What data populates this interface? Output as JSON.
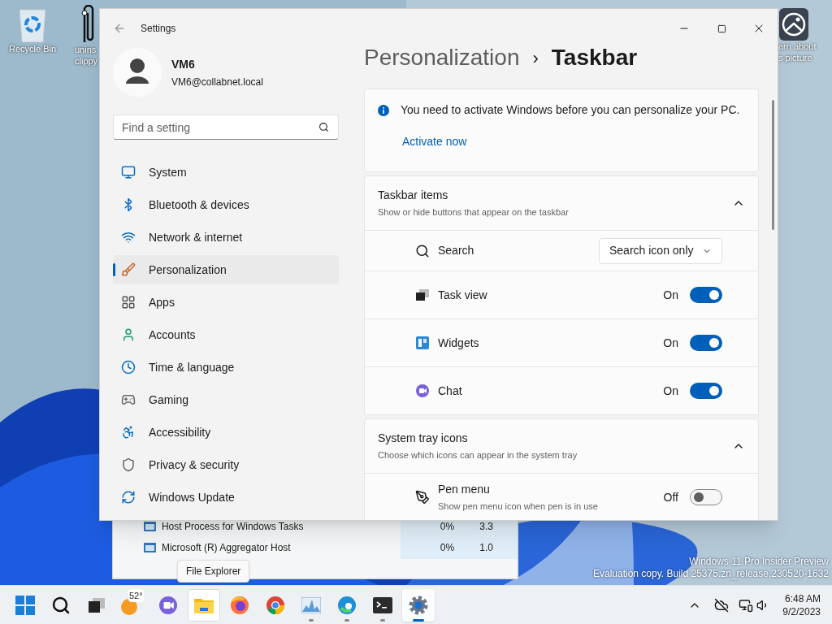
{
  "desktop_icons": [
    {
      "lines": [
        "Recycle Bin"
      ]
    },
    {
      "lines": [
        "unins",
        "clippy"
      ]
    },
    {
      "lines": [
        "arn about",
        "s picture"
      ]
    }
  ],
  "watermark_os": [
    "Windows 11 Pro Insider Preview",
    "Evaluation copy. Build 25375.zn_release.230520-1632"
  ],
  "background_window": {
    "rows": [
      {
        "name": "Host Process for Windows Tasks",
        "cpu": "0%",
        "memory": "3.3"
      },
      {
        "name": "Microsoft (R) Aggregator Host",
        "cpu": "0%",
        "memory": "1.0"
      }
    ]
  },
  "tooltip": "File Explorer",
  "settings": {
    "title": "Settings",
    "user": {
      "name": "VM6",
      "email": "VM6@collabnet.local"
    },
    "search": {
      "placeholder": "Find a setting"
    },
    "nav": [
      {
        "label": "System",
        "selected": false
      },
      {
        "label": "Bluetooth & devices",
        "selected": false
      },
      {
        "label": "Network & internet",
        "selected": false
      },
      {
        "label": "Personalization",
        "selected": true
      },
      {
        "label": "Apps",
        "selected": false
      },
      {
        "label": "Accounts",
        "selected": false
      },
      {
        "label": "Time & language",
        "selected": false
      },
      {
        "label": "Gaming",
        "selected": false
      },
      {
        "label": "Accessibility",
        "selected": false
      },
      {
        "label": "Privacy & security",
        "selected": false
      },
      {
        "label": "Windows Update",
        "selected": false
      }
    ],
    "breadcrumb": {
      "parent": "Personalization",
      "separator": "›",
      "current": "Taskbar"
    },
    "notice": {
      "text": "You need to activate Windows before you can personalize your PC.",
      "link": "Activate now"
    },
    "sections": [
      {
        "title": "Taskbar items",
        "subtitle": "Show or hide buttons that appear on the taskbar",
        "expanded": true,
        "rows": [
          {
            "kind": "dropdown",
            "label": "Search",
            "value": "Search icon only"
          },
          {
            "kind": "toggle",
            "label": "Task view",
            "state_label": "On",
            "on": true
          },
          {
            "kind": "toggle",
            "label": "Widgets",
            "state_label": "On",
            "on": true
          },
          {
            "kind": "toggle",
            "label": "Chat",
            "state_label": "On",
            "on": true
          }
        ]
      },
      {
        "title": "System tray icons",
        "subtitle": "Choose which icons can appear in the system tray",
        "expanded": true,
        "rows": [
          {
            "kind": "toggle",
            "label": "Pen menu",
            "description": "Show pen menu icon when pen is in use",
            "state_label": "Off",
            "on": false
          }
        ]
      }
    ]
  },
  "taskbar": {
    "apps": [
      {
        "running": false,
        "selected": false,
        "hovered": false
      },
      {
        "running": false,
        "selected": false,
        "hovered": false
      },
      {
        "running": false,
        "selected": false,
        "hovered": false
      },
      {
        "running": false,
        "selected": false,
        "hovered": false,
        "badge": "52°"
      },
      {
        "running": false,
        "selected": false,
        "hovered": false
      },
      {
        "running": false,
        "selected": false,
        "hovered": true
      },
      {
        "running": false,
        "selected": false,
        "hovered": false
      },
      {
        "running": false,
        "selected": false,
        "hovered": false
      },
      {
        "running": true,
        "selected": false,
        "hovered": false
      },
      {
        "running": true,
        "selected": false,
        "hovered": false
      },
      {
        "running": true,
        "selected": false,
        "hovered": false
      },
      {
        "running": true,
        "selected": true,
        "hovered": false
      }
    ],
    "time": "6:48 AM",
    "date": "9/2/2023"
  }
}
